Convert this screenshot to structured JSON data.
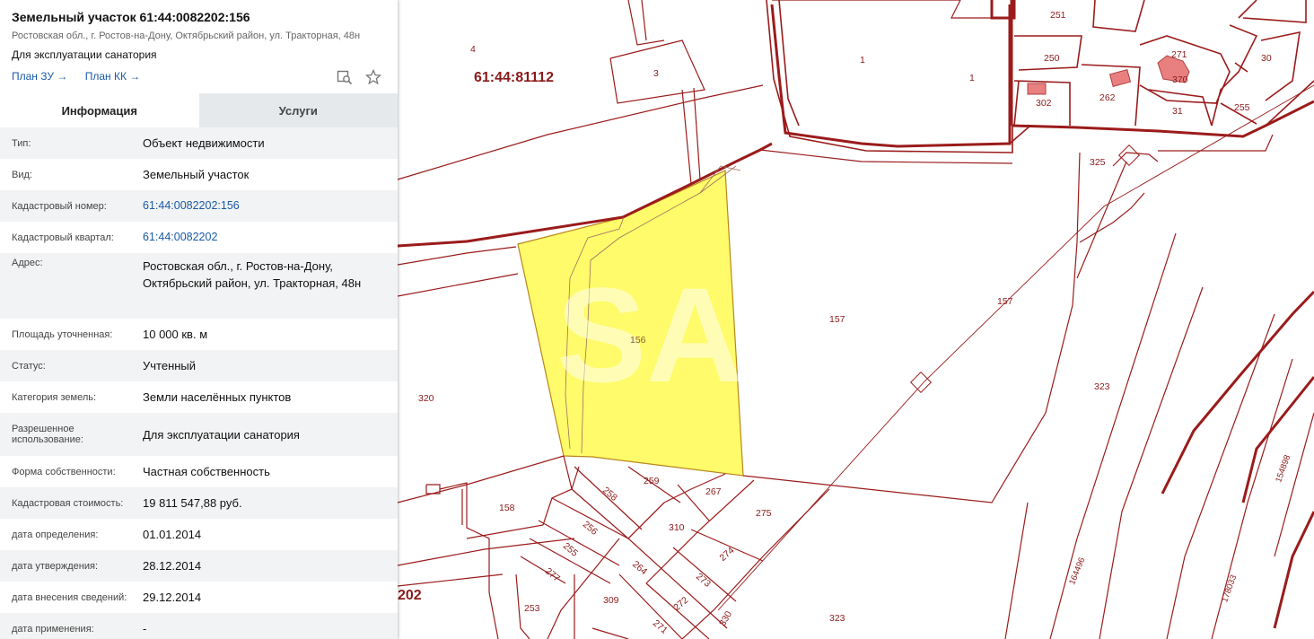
{
  "colors": {
    "boundary": "#9b1b1b",
    "parcel_fill": "#fffb6a",
    "building_fill": "#e88080",
    "link": "#1a5aa6",
    "label": "#8b1a1a"
  },
  "panel": {
    "title": "Земельный участок 61:44:0082202:156",
    "address_short": "Ростовская обл., г. Ростов-на-Дону, Октябрьский район, ул. Тракторная, 48н",
    "usage": "Для эксплуатации санатория",
    "links": [
      "План ЗУ →",
      "План КК →"
    ],
    "icons": [
      "search-map-icon",
      "star-icon"
    ],
    "tabs": [
      {
        "label": "Информация",
        "active": true
      },
      {
        "label": "Услуги",
        "active": false
      }
    ],
    "fields": [
      {
        "key": "Тип:",
        "value": "Объект недвижимости"
      },
      {
        "key": "Вид:",
        "value": "Земельный участок"
      },
      {
        "key": "Кадастровый номер:",
        "value": "61:44:0082202:156",
        "link": true
      },
      {
        "key": "Кадастровый квартал:",
        "value": "61:44:0082202",
        "link": true
      },
      {
        "key": "Адрес:",
        "value": "Ростовская обл., г. Ростов-на-Дону, Октябрьский район, ул. Тракторная, 48н"
      },
      {
        "key": "Площадь уточненная:",
        "value": "10 000 кв. м"
      },
      {
        "key": "Статус:",
        "value": "Учтенный"
      },
      {
        "key": "Категория земель:",
        "value": "Земли населённых пунктов"
      },
      {
        "key": "Разрешенное использование:",
        "value": "Для эксплуатации санатория"
      },
      {
        "key": "Форма собственности:",
        "value": "Частная собственность"
      },
      {
        "key": "Кадастровая стоимость:",
        "value": "19 811 547,88 руб."
      },
      {
        "key": "дата определения:",
        "value": "01.01.2014"
      },
      {
        "key": "дата утверждения:",
        "value": "28.12.2014"
      },
      {
        "key": "дата внесения сведений:",
        "value": "29.12.2014"
      },
      {
        "key": "дата применения:",
        "value": "-"
      }
    ]
  },
  "map": {
    "quarter_label": "61:44:81112",
    "edge_label": "202",
    "parcel_labels": [
      "4",
      "3",
      "1",
      "1",
      "251",
      "250",
      "271",
      "370",
      "30",
      "302",
      "262",
      "31",
      "255",
      "325",
      "156",
      "157",
      "157",
      "320",
      "323",
      "323",
      "158",
      "258",
      "259",
      "267",
      "275",
      "256",
      "310",
      "255",
      "274",
      "277",
      "264",
      "273",
      "309",
      "272",
      "253",
      "271",
      "330",
      "164496",
      "154898",
      "178033"
    ]
  }
}
